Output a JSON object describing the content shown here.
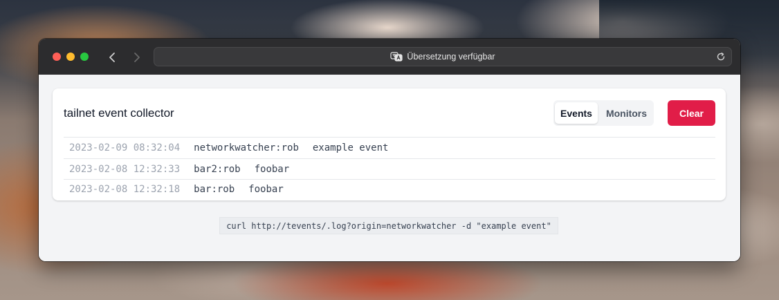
{
  "browser": {
    "address_text": "Übersetzung verfügbar",
    "icons": {
      "back": "chevron-left-icon",
      "forward": "chevron-right-icon",
      "translate": "translate-icon",
      "reload": "reload-icon"
    }
  },
  "app": {
    "title": "tailnet event collector",
    "tabs": [
      {
        "label": "Events",
        "active": true
      },
      {
        "label": "Monitors",
        "active": false
      }
    ],
    "clear_label": "Clear",
    "accent_color": "#e11d48"
  },
  "events": [
    {
      "timestamp": "2023-02-09 08:32:04",
      "origin": "networkwatcher:rob",
      "message": "example event"
    },
    {
      "timestamp": "2023-02-08 12:32:33",
      "origin": "bar2:rob",
      "message": "foobar"
    },
    {
      "timestamp": "2023-02-08 12:32:18",
      "origin": "bar:rob",
      "message": "foobar"
    }
  ],
  "footer": {
    "curl_example": "curl http://tevents/.log?origin=networkwatcher -d \"example event\""
  }
}
